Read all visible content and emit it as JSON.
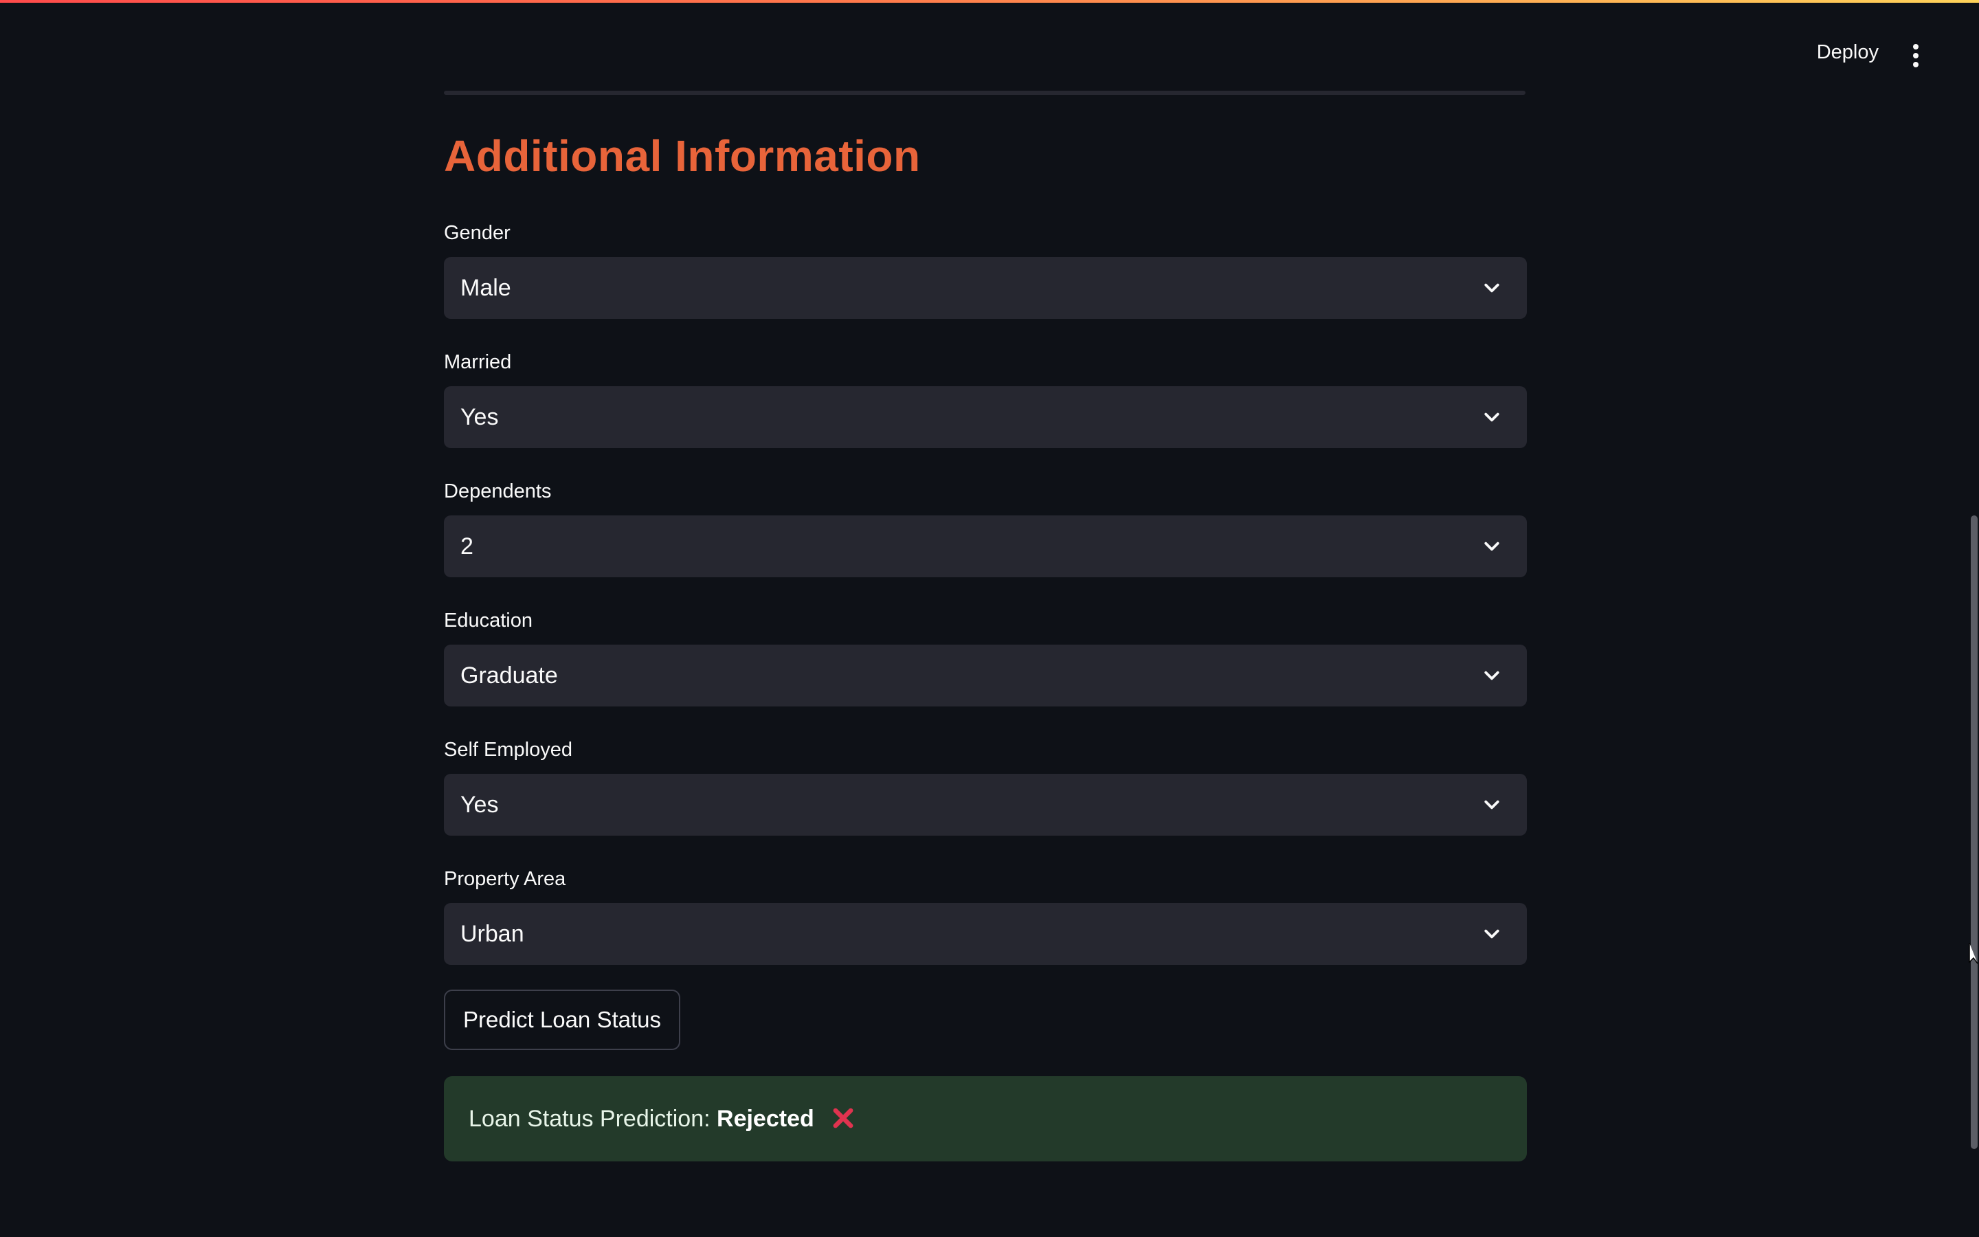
{
  "header": {
    "deploy_label": "Deploy",
    "menu_icon": "kebab-menu-icon"
  },
  "section": {
    "title": "Additional Information"
  },
  "fields": [
    {
      "label": "Gender",
      "value": "Male"
    },
    {
      "label": "Married",
      "value": "Yes"
    },
    {
      "label": "Dependents",
      "value": "2"
    },
    {
      "label": "Education",
      "value": "Graduate"
    },
    {
      "label": "Self Employed",
      "value": "Yes"
    },
    {
      "label": "Property Area",
      "value": "Urban"
    }
  ],
  "predict_button": {
    "label": "Predict Loan Status"
  },
  "result": {
    "prefix": "Loan Status Prediction: ",
    "status": "Rejected",
    "icon": "cross-mark-icon"
  },
  "colors": {
    "accent": "#e8643a",
    "background": "#0e1117",
    "select_bg": "#262730",
    "result_bg": "#233a2a",
    "cross": "#e0334f"
  }
}
